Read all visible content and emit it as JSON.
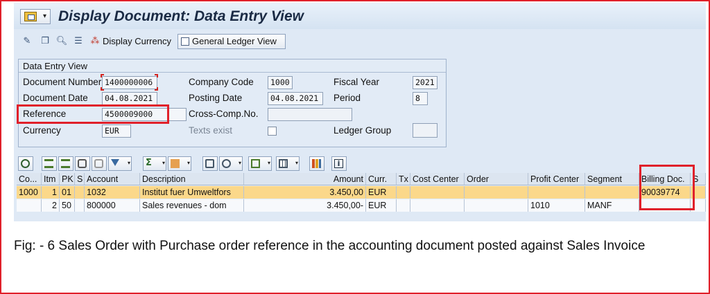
{
  "window": {
    "title": "Display Document: Data Entry View"
  },
  "toolbar": {
    "display_currency_label": "Display Currency",
    "general_ledger_view_label": "General Ledger View"
  },
  "data_entry_group": {
    "title": "Data Entry View",
    "document_number_label": "Document Number",
    "document_number_value": "1400000006",
    "company_code_label": "Company Code",
    "company_code_value": "1000",
    "fiscal_year_label": "Fiscal Year",
    "fiscal_year_value": "2021",
    "document_date_label": "Document Date",
    "document_date_value": "04.08.2021",
    "posting_date_label": "Posting Date",
    "posting_date_value": "04.08.2021",
    "period_label": "Period",
    "period_value": "8",
    "reference_label": "Reference",
    "reference_value": "4500009000",
    "cross_comp_label": "Cross-Comp.No.",
    "cross_comp_value": "",
    "currency_label": "Currency",
    "currency_value": "EUR",
    "texts_exist_label": "Texts exist",
    "ledger_group_label": "Ledger Group",
    "ledger_group_value": ""
  },
  "table": {
    "columns": [
      "Co...",
      "Itm",
      "PK",
      "S",
      "Account",
      "Description",
      "Amount",
      "Curr.",
      "Tx",
      "Cost Center",
      "Order",
      "Profit Center",
      "Segment",
      "Billing Doc.",
      "S"
    ],
    "rows": [
      {
        "co": "1000",
        "itm": "1",
        "pk": "01",
        "s": "",
        "account": "1032",
        "description": "Institut fuer Umweltfors",
        "amount": "3.450,00",
        "curr": "EUR",
        "tx": "",
        "cost_center": "",
        "order": "",
        "profit_center": "",
        "segment": "",
        "billing_doc": "90039774"
      },
      {
        "co": "",
        "itm": "2",
        "pk": "50",
        "s": "",
        "account": "800000",
        "description": "Sales revenues - dom",
        "amount": "3.450,00-",
        "curr": "EUR",
        "tx": "",
        "cost_center": "",
        "order": "",
        "profit_center": "1010",
        "segment": "MANF",
        "billing_doc": ""
      }
    ]
  },
  "caption": "Fig: - 6 Sales Order with Purchase order reference in the accounting document posted against Sales Invoice",
  "colors": {
    "highlight_red": "#e0202a",
    "selected_row": "#fbd88a",
    "sap_background": "#dfe9f5"
  }
}
